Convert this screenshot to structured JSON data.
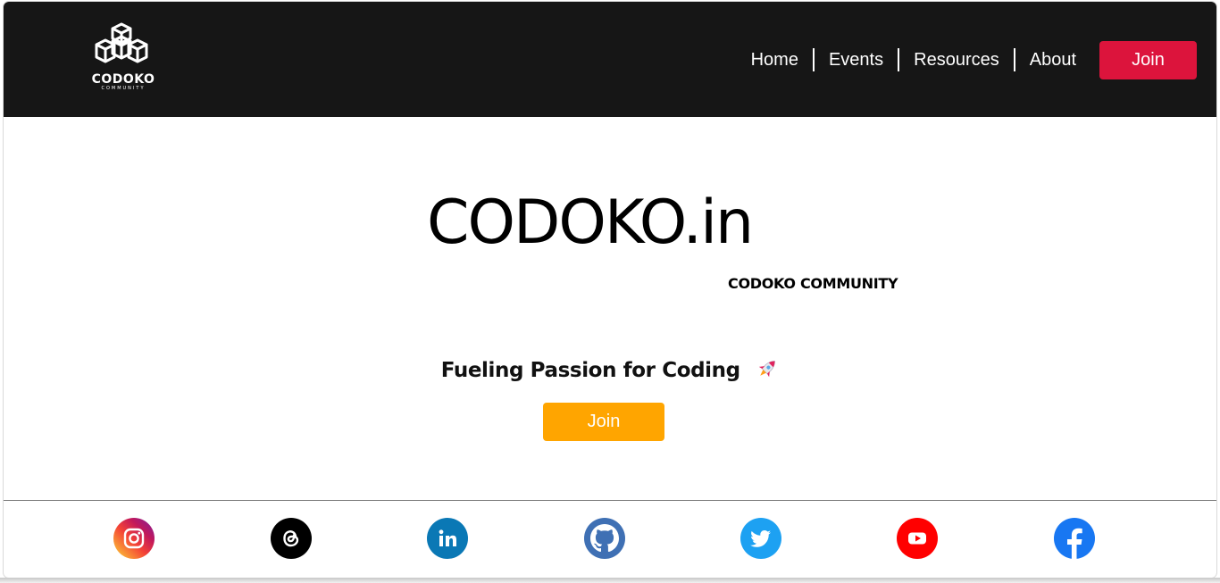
{
  "header": {
    "logo_text": "CODOKO",
    "logo_subtext": "COMMUNITY",
    "nav": [
      "Home",
      "Events",
      "Resources",
      "About"
    ],
    "join_label": "Join"
  },
  "hero": {
    "title": "CODOKO.in",
    "subtitle": "CODOKO COMMUNITY",
    "tagline": "Fueling Passion for Coding",
    "join_label": "Join"
  },
  "colors": {
    "header_bg": "#161616",
    "nav_join": "#dc143c",
    "hero_join": "#ffa500"
  },
  "social_icons": [
    "instagram-icon",
    "threads-icon",
    "linkedin-icon",
    "github-icon",
    "twitter-icon",
    "youtube-icon",
    "facebook-icon"
  ]
}
